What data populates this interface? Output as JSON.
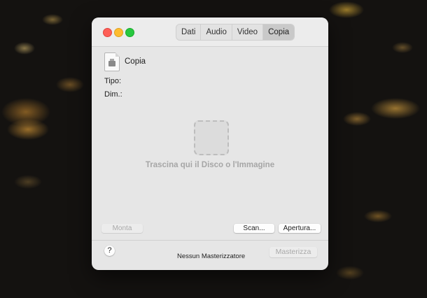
{
  "window": {
    "tabs": [
      {
        "label": "Dati",
        "active": false
      },
      {
        "label": "Audio",
        "active": false
      },
      {
        "label": "Video",
        "active": false
      },
      {
        "label": "Copia",
        "active": true
      }
    ],
    "file": {
      "name": "Copia",
      "icon": "disk-image-icon"
    },
    "fields": {
      "type_label": "Tipo:",
      "size_label": "Dim.:"
    },
    "drop_zone": {
      "text": "Trascina qui il Disco o l'Immagine"
    },
    "buttons": {
      "mount": {
        "label": "Monta",
        "enabled": false
      },
      "scan": {
        "label": "Scan...",
        "enabled": true
      },
      "open": {
        "label": "Apertura...",
        "enabled": true
      },
      "help": {
        "label": "?"
      },
      "burn": {
        "label": "Masterizza",
        "enabled": false
      }
    },
    "status": {
      "burner": "Nessun Masterizzatore"
    }
  },
  "colors": {
    "close": "#fe5f57",
    "minimize": "#febc2e",
    "maximize": "#28c840",
    "window_bg": "#e6e6e6",
    "desktop_bg": "#141210"
  }
}
